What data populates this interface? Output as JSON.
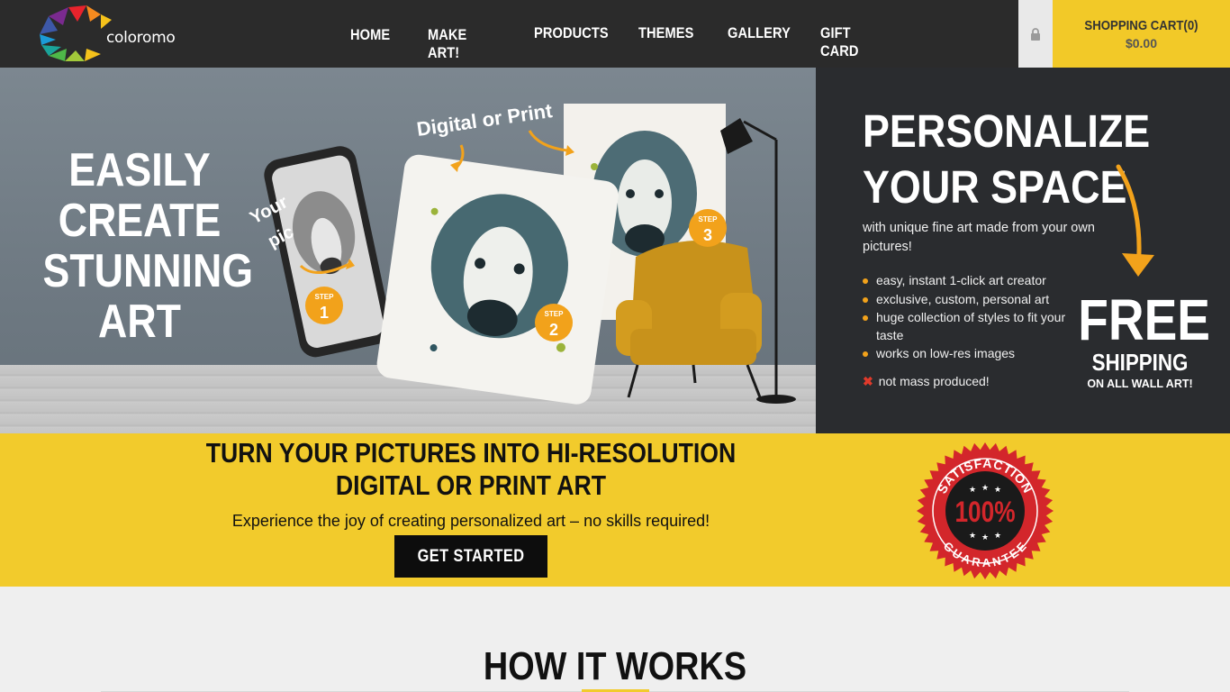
{
  "header": {
    "logo_text": "coloromo",
    "nav": [
      "HOME",
      "MAKE ART!",
      "PRODUCTS",
      "THEMES",
      "GALLERY",
      "GIFT CARD"
    ],
    "cart_label": "SHOPPING CART(0)",
    "cart_total": "$0.00"
  },
  "hero": {
    "title_lines": [
      "EASILY",
      "CREATE",
      "STUNNING",
      "ART"
    ],
    "annot_digital": "Digital or Print",
    "annot_yourpic_1": "Your",
    "annot_yourpic_2": "pic",
    "step_label": "STEP",
    "step1": "1",
    "step2": "2",
    "step3": "3"
  },
  "panel": {
    "title_line1": "PERSONALIZE",
    "title_line2": "YOUR SPACE",
    "subtitle": "with unique fine art made from your own pictures!",
    "bullets": [
      "easy, instant 1-click art creator",
      "exclusive, custom, personal art",
      "huge collection of styles to fit your taste",
      "works on low-res images"
    ],
    "negative": "not mass produced!",
    "free": "FREE",
    "shipping": "SHIPPING",
    "on_all": "ON ALL WALL ART!"
  },
  "band": {
    "title": "TURN YOUR PICTURES INTO HI-RESOLUTION DIGITAL OR PRINT ART",
    "subtitle": "Experience the joy of creating personalized art – no skills required!",
    "button": "GET STARTED",
    "seal_top": "SATISFACTION",
    "seal_mid": "100%",
    "seal_bottom": "GUARANTEE"
  },
  "how": {
    "title": "HOW IT WORKS"
  },
  "colors": {
    "accent_yellow": "#f2cb2c",
    "header_bg": "#2b2b2b",
    "panel_bg": "#2a2c2f",
    "orange": "#f2a21b",
    "seal_red": "#d3262b"
  }
}
